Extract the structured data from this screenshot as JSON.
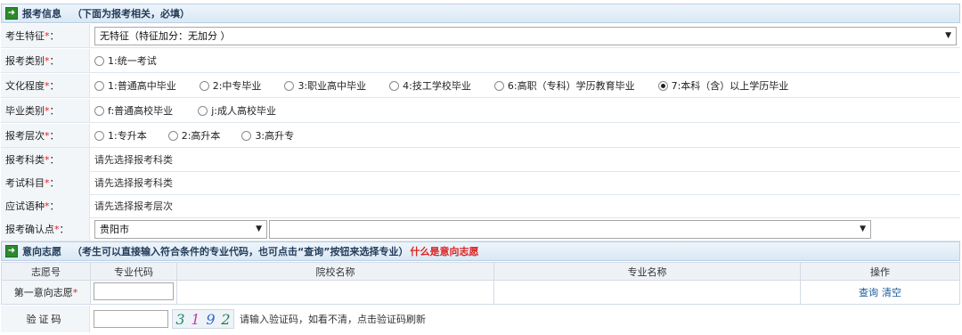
{
  "section1": {
    "title": "报考信息",
    "note": "（下面为报考相关，必填）"
  },
  "fields": {
    "trait": {
      "label": "考生特征",
      "req": "*",
      "suffix": "：",
      "value": "无特征（特征加分：无加分 ）"
    },
    "category": {
      "label": "报考类别",
      "req": "*",
      "suffix": "：",
      "option": "1:统一考试"
    },
    "education": {
      "label": "文化程度",
      "req": "*",
      "suffix": "：",
      "options": [
        "1:普通高中毕业",
        "2:中专毕业",
        "3:职业高中毕业",
        "4:技工学校毕业",
        "6:高职（专科）学历教育毕业",
        "7:本科（含）以上学历毕业"
      ],
      "selected": "7:本科（含）以上学历毕业"
    },
    "grad_type": {
      "label": "毕业类别",
      "req": "*",
      "suffix": "：",
      "options": [
        "f:普通高校毕业",
        "j:成人高校毕业"
      ]
    },
    "level": {
      "label": "报考层次",
      "req": "*",
      "suffix": "：",
      "options": [
        "1:专升本",
        "2:高升本",
        "3:高升专"
      ]
    },
    "subject_cat": {
      "label": "报考科类",
      "req": "*",
      "suffix": "：",
      "value": "请先选择报考科类"
    },
    "exam_subject": {
      "label": "考试科目",
      "req": "*",
      "suffix": "：",
      "value": "请先选择报考科类"
    },
    "language": {
      "label": "应试语种",
      "req": "*",
      "suffix": "：",
      "value": "请先选择报考层次"
    },
    "confirm_point": {
      "label": "报考确认点",
      "req": "*",
      "suffix": "：",
      "city": "贵阳市",
      "site": ""
    }
  },
  "section2": {
    "title": "意向志愿",
    "note": "（考生可以直接输入符合条件的专业代码，也可点击“查询”按钮来选择专业）",
    "link": "什么是意向志愿"
  },
  "pref_table": {
    "headers": [
      "志愿号",
      "专业代码",
      "院校名称",
      "专业名称",
      "操作"
    ],
    "row": {
      "label": "第一意向志愿",
      "req": "*",
      "query": "查询",
      "clear": "清空"
    }
  },
  "captcha": {
    "label": "验证码",
    "digits": [
      "3",
      "1",
      "9",
      "2"
    ],
    "hint": "请输入验证码，如看不清，点击验证码刷新"
  }
}
